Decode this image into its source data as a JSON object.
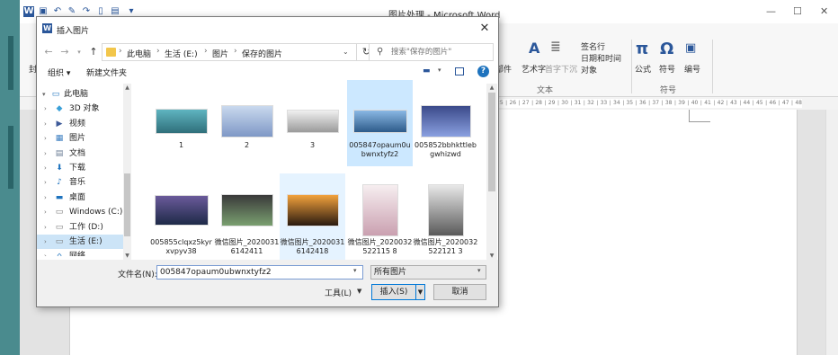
{
  "word": {
    "title": "图片处理 - Microsoft Word",
    "ribbon": {
      "labels": [
        "签名行",
        "日期和时间",
        "对象",
        "公式",
        "符号",
        "编号",
        "艺术字",
        "首字下沉",
        "档部件",
        "文本",
        "符号"
      ],
      "text_group": "文本",
      "symbol_group": "符号",
      "left_tab_fragment": "封"
    },
    "ruler_text": "25 ∣ 26 ∣ 27 ∣ 28 ∣ 29 ∣ 30 ∣ 31 ∣ 32 ∣ 33 ∣ 34 ∣ 35 ∣ 36 ∣ 37 ∣ 38 ∣ 39 ∣ 40 ∣ 41 ∣ 42 ∣ 43 ∣ 44 ∣ 45 ∣ 46 ∣ 47 ∣ 48"
  },
  "dialog": {
    "title": "插入图片",
    "breadcrumbs": [
      "此电脑",
      "生活 (E:)",
      "图片",
      "保存的图片"
    ],
    "search_placeholder": "搜索\"保存的图片\"",
    "organize_label": "组织 ▾",
    "new_folder_label": "新建文件夹",
    "nav_items": [
      {
        "label": "此电脑",
        "icon": "computer-icon",
        "caret": "▾"
      },
      {
        "label": "3D 对象",
        "icon": "3d-objects-icon",
        "caret": "›"
      },
      {
        "label": "视频",
        "icon": "video-icon",
        "caret": "›"
      },
      {
        "label": "图片",
        "icon": "pictures-icon",
        "caret": "›"
      },
      {
        "label": "文档",
        "icon": "documents-icon",
        "caret": "›"
      },
      {
        "label": "下载",
        "icon": "download-icon",
        "caret": "›"
      },
      {
        "label": "音乐",
        "icon": "music-icon",
        "caret": "›"
      },
      {
        "label": "桌面",
        "icon": "desktop-icon",
        "caret": "›"
      },
      {
        "label": "Windows (C:)",
        "icon": "drive-icon",
        "caret": "›"
      },
      {
        "label": "工作 (D:)",
        "icon": "drive-icon",
        "caret": "›"
      },
      {
        "label": "生活 (E:)",
        "icon": "drive-icon",
        "caret": "›"
      },
      {
        "label": "网络",
        "icon": "network-icon",
        "caret": "›"
      }
    ],
    "files": [
      {
        "name": "1",
        "colors": [
          "#5fb4c0",
          "#2f6f7a"
        ]
      },
      {
        "name": "2",
        "colors": [
          "#c9d9ee",
          "#7f98c6"
        ]
      },
      {
        "name": "3",
        "colors": [
          "#f0f0f0",
          "#9a9a9a"
        ]
      },
      {
        "name": "005847opaum0ubwnxtyfz2",
        "colors": [
          "#8ab8e4",
          "#2d5b8a"
        ]
      },
      {
        "name": "005852bbhkttlebgwhizwd",
        "colors": [
          "#3b4a8a",
          "#8aa0e0"
        ]
      },
      {
        "name": "005855clqxz5kyrxvpyv38",
        "colors": [
          "#6a5a9a",
          "#1e2a48"
        ]
      },
      {
        "name": "微信图片_20200316142411",
        "colors": [
          "#3a3a3a",
          "#7aa070"
        ]
      },
      {
        "name": "微信图片_20200316142418",
        "colors": [
          "#f3a23c",
          "#2a1a10"
        ]
      },
      {
        "name": "微信图片_2020032522115 8",
        "colors": [
          "#f6eef0",
          "#caa0b0"
        ]
      },
      {
        "name": "微信图片_2020032522121 3",
        "colors": [
          "#e8e8e8",
          "#5a5a5a"
        ]
      }
    ],
    "filename_label": "文件名(N):",
    "filename_value": "005847opaum0ubwnxtyfz2",
    "filetype_value": "所有图片",
    "tools_label": "工具(L)",
    "insert_label": "插入(S)",
    "cancel_label": "取消"
  }
}
